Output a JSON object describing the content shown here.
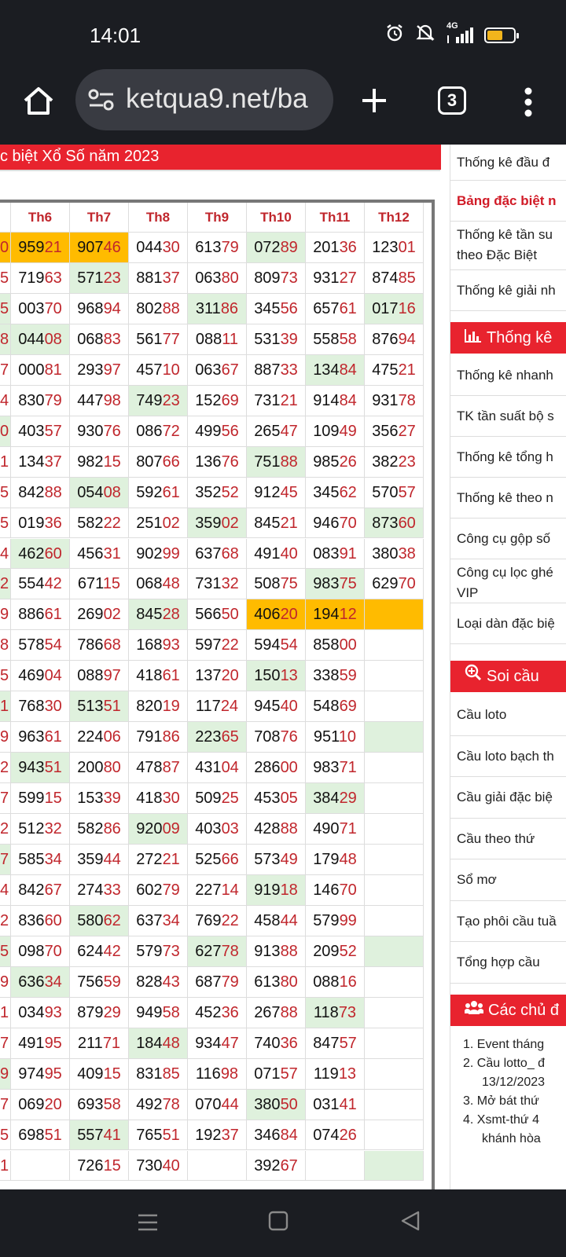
{
  "status": {
    "time": "14:01",
    "net_label": "4G",
    "battery_level": 0.6
  },
  "browser": {
    "url": "ketqua9.net/ba",
    "tab_count": "3"
  },
  "page": {
    "header_title": "c biệt Xổ Số năm 2023"
  },
  "table": {
    "columns": [
      "Th6",
      "Th7",
      "Th8",
      "Th9",
      "Th10",
      "Th11",
      "Th12"
    ],
    "left_edge": [
      "0",
      "5",
      "5",
      "8",
      "7",
      "4",
      "0",
      "1",
      "5",
      "5",
      "4",
      "2",
      "9",
      "8",
      "5",
      "1",
      "9",
      "2",
      "7",
      "2",
      "7",
      "4",
      "2",
      "5",
      "9",
      "1",
      "7",
      "9",
      "7",
      "5",
      "1"
    ],
    "rows": [
      [
        "95921",
        "90746",
        "04430",
        "61379",
        "07289",
        "20136",
        "12301"
      ],
      [
        "71963",
        "57123",
        "88137",
        "06380",
        "80973",
        "93127",
        "87485"
      ],
      [
        "00370",
        "96894",
        "80288",
        "31186",
        "34556",
        "65761",
        "01716"
      ],
      [
        "04408",
        "06883",
        "56177",
        "08811",
        "53139",
        "55858",
        "87694"
      ],
      [
        "00081",
        "29397",
        "45710",
        "06367",
        "88733",
        "13484",
        "47521"
      ],
      [
        "83079",
        "44798",
        "74923",
        "15269",
        "73121",
        "91484",
        "93178"
      ],
      [
        "40357",
        "93076",
        "08672",
        "49956",
        "26547",
        "10949",
        "35627"
      ],
      [
        "13437",
        "98215",
        "80766",
        "13676",
        "75188",
        "98526",
        "38223"
      ],
      [
        "84288",
        "05408",
        "59261",
        "35252",
        "91245",
        "34562",
        "57057"
      ],
      [
        "01936",
        "58222",
        "25102",
        "35902",
        "84521",
        "94670",
        "87360"
      ],
      [
        "46260",
        "45631",
        "90299",
        "63768",
        "49140",
        "08391",
        "38038"
      ],
      [
        "55442",
        "67115",
        "06848",
        "73132",
        "50875",
        "98375",
        "62970"
      ],
      [
        "88661",
        "26902",
        "84528",
        "56650",
        "40620",
        "19412",
        ""
      ],
      [
        "57854",
        "78668",
        "16893",
        "59722",
        "59454",
        "85800",
        ""
      ],
      [
        "46904",
        "08897",
        "41861",
        "13720",
        "15013",
        "33859",
        ""
      ],
      [
        "76830",
        "51351",
        "82019",
        "11724",
        "94540",
        "54869",
        ""
      ],
      [
        "96361",
        "22406",
        "79186",
        "22365",
        "70876",
        "95110",
        ""
      ],
      [
        "94351",
        "20080",
        "47887",
        "43104",
        "28600",
        "98371",
        ""
      ],
      [
        "59915",
        "15339",
        "41830",
        "50925",
        "45305",
        "38429",
        ""
      ],
      [
        "51232",
        "58286",
        "92009",
        "40303",
        "42888",
        "49071",
        ""
      ],
      [
        "58534",
        "35944",
        "27221",
        "52566",
        "57349",
        "17948",
        ""
      ],
      [
        "84267",
        "27433",
        "60279",
        "22714",
        "91918",
        "14670",
        ""
      ],
      [
        "83660",
        "58062",
        "63734",
        "76922",
        "45844",
        "57999",
        ""
      ],
      [
        "09870",
        "62442",
        "57973",
        "62778",
        "91388",
        "20952",
        ""
      ],
      [
        "63634",
        "75659",
        "82843",
        "68779",
        "61380",
        "08816",
        ""
      ],
      [
        "03493",
        "87929",
        "94958",
        "45236",
        "26788",
        "11873",
        ""
      ],
      [
        "49195",
        "21171",
        "18448",
        "93447",
        "74036",
        "84757",
        ""
      ],
      [
        "97495",
        "40915",
        "83185",
        "11698",
        "07157",
        "11913",
        ""
      ],
      [
        "06920",
        "69358",
        "49278",
        "07044",
        "38050",
        "03141",
        ""
      ],
      [
        "69851",
        "55741",
        "76551",
        "19237",
        "34684",
        "07426",
        ""
      ],
      [
        "",
        "72615",
        "73040",
        "",
        "39267",
        "",
        ""
      ]
    ],
    "highlight_orange": [
      [
        0,
        0
      ],
      [
        0,
        1
      ],
      [
        12,
        4
      ],
      [
        12,
        5
      ],
      [
        12,
        6
      ]
    ],
    "highlight_green": [
      [
        0,
        4
      ],
      [
        1,
        1
      ],
      [
        2,
        3
      ],
      [
        2,
        6
      ],
      [
        3,
        0
      ],
      [
        4,
        5
      ],
      [
        5,
        2
      ],
      [
        7,
        4
      ],
      [
        8,
        1
      ],
      [
        9,
        3
      ],
      [
        9,
        6
      ],
      [
        10,
        0
      ],
      [
        11,
        5
      ],
      [
        12,
        2
      ],
      [
        14,
        4
      ],
      [
        15,
        1
      ],
      [
        16,
        3
      ],
      [
        16,
        6
      ],
      [
        17,
        0
      ],
      [
        18,
        5
      ],
      [
        19,
        2
      ],
      [
        21,
        4
      ],
      [
        22,
        1
      ],
      [
        23,
        3
      ],
      [
        23,
        6
      ],
      [
        24,
        0
      ],
      [
        25,
        5
      ],
      [
        26,
        2
      ],
      [
        28,
        4
      ],
      [
        29,
        1
      ],
      [
        30,
        6
      ]
    ],
    "left_edge_green": [
      2,
      3,
      6,
      11,
      15,
      20,
      23,
      27
    ]
  },
  "sidebar": {
    "top_items": [
      {
        "label": "Thống kê đầu đ",
        "red": false
      },
      {
        "label": "Bảng đặc biệt n",
        "red": true
      },
      {
        "label": "Thống kê tần su theo Đặc Biệt",
        "red": false
      },
      {
        "label": "Thống kê giải nh",
        "red": false
      }
    ],
    "section1_title": "Thống kê",
    "section1_items": [
      "Thống kê nhanh",
      "TK tần suất bộ s",
      "Thống kê tổng h",
      "Thống kê theo n",
      "Công cụ gộp số",
      "Công cụ lọc ghé VIP",
      "Loại dàn đặc biệ"
    ],
    "section2_title": "Soi cầu",
    "section2_items": [
      "Cầu loto",
      "Cầu loto bạch th",
      "Cầu giải đặc biệ",
      "Cầu theo thứ",
      "Sổ mơ",
      "Tạo phôi cầu tuầ",
      "Tổng hợp cầu"
    ],
    "section3_title": "Các chủ đ",
    "section3_items": [
      "1. Event tháng",
      "2. Cầu lotto_ đ",
      "13/12/2023",
      "3. Mở bát thứ",
      "4. Xsmt-thứ 4",
      "khánh hòa"
    ]
  }
}
